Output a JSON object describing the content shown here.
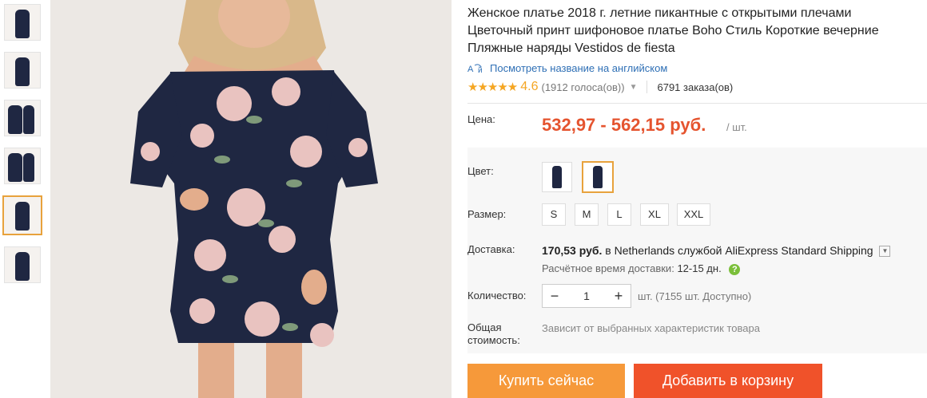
{
  "product": {
    "title": "Женское платье 2018 г. летние пикантные с открытыми плечами Цветочный принт шифоновое платье Boho Стиль Короткие вечерние Пляжные наряды Vestidos de fiesta",
    "translate_link": "Посмотреть название на английском",
    "rating": {
      "stars": "★★★★★",
      "score": "4.6",
      "votes": "(1912 голоса(ов))",
      "orders": "6791 заказа(ов)"
    }
  },
  "price": {
    "label": "Цена:",
    "value": "532,97 - 562,15 руб.",
    "unit": "/ шт."
  },
  "options": {
    "color_label": "Цвет:",
    "size_label": "Размер:",
    "sizes": [
      "S",
      "M",
      "L",
      "XL",
      "XXL"
    ]
  },
  "shipping": {
    "label": "Доставка:",
    "cost": "170,53 руб.",
    "to_text": "в Netherlands службой AliExpress Standard Shipping",
    "est_label": "Расчётное время доставки:",
    "est_days": "12-15 дн."
  },
  "quantity": {
    "label": "Количество:",
    "minus": "−",
    "value": "1",
    "plus": "+",
    "available": "шт. (7155 шт. Доступно)"
  },
  "total": {
    "label_line1": "Общая",
    "label_line2": "стоимость:",
    "note": "Зависит от выбранных характеристик товара"
  },
  "actions": {
    "buy_now": "Купить сейчас",
    "add_to_cart": "Добавить в корзину"
  },
  "colors": {
    "accent": "#e5542f",
    "buy_button": "#f6993a",
    "cart_button": "#f0522a",
    "star": "#f5a623",
    "link": "#2e6fb5",
    "dress_navy": "#1f2742"
  }
}
